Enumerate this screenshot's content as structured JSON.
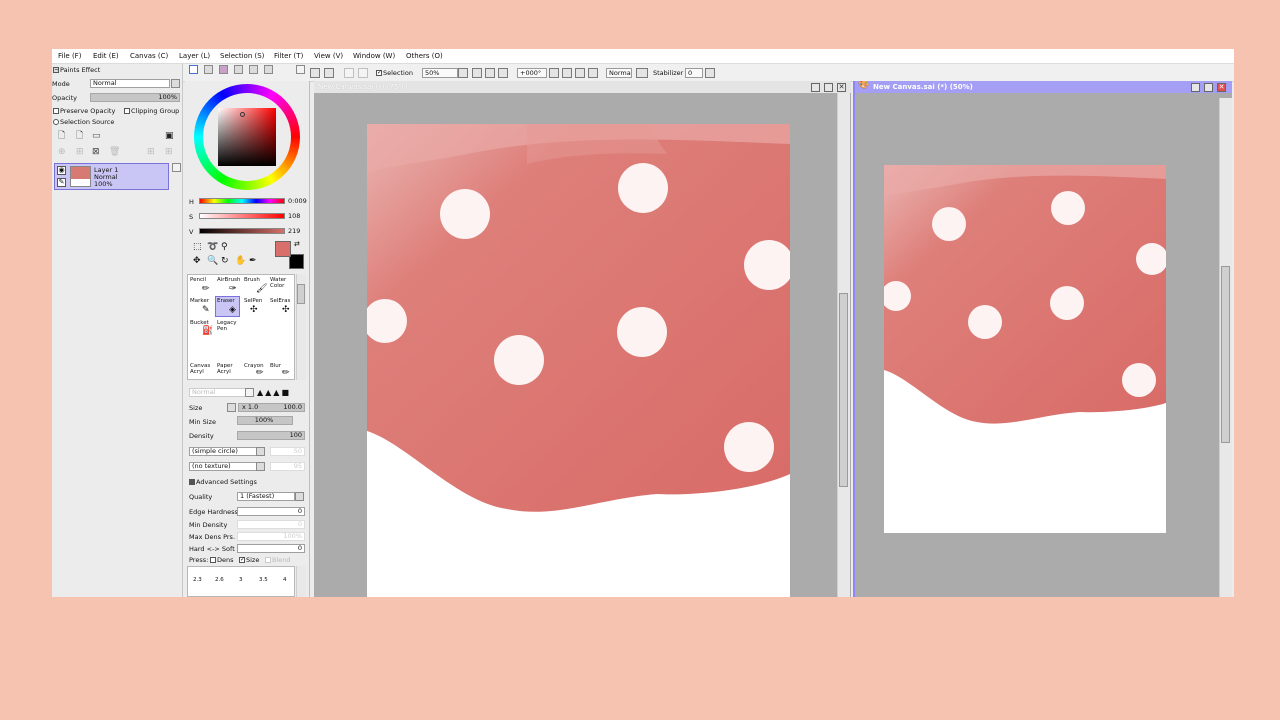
{
  "menu": [
    {
      "label": "File (F)"
    },
    {
      "label": "Edit (E)"
    },
    {
      "label": "Canvas (C)"
    },
    {
      "label": "Layer (L)"
    },
    {
      "label": "Selection (S)"
    },
    {
      "label": "Filter (T)"
    },
    {
      "label": "View (V)"
    },
    {
      "label": "Window (W)"
    },
    {
      "label": "Others (O)"
    }
  ],
  "toolbar": {
    "selection_label": "Selection",
    "zoom": "50%",
    "rotation": "+000°",
    "blend": "Normal",
    "stabilizer_label": "Stabilizer",
    "stabilizer_value": "0"
  },
  "layers_panel": {
    "paints_effect": "Paints Effect",
    "mode_label": "Mode",
    "mode_value": "Normal",
    "opacity_label": "Opacity",
    "opacity_value": "100%",
    "preserve_opacity": "Preserve Opacity",
    "clipping_group": "Clipping Group",
    "selection_source": "Selection Source",
    "layer": {
      "name": "Layer 1",
      "mode": "Normal",
      "opacity": "100%"
    }
  },
  "color": {
    "h_label": "H",
    "h_value": "0:009",
    "s_label": "S",
    "s_value": "108",
    "v_label": "V",
    "v_value": "219",
    "primary": "#d86f6a",
    "secondary": "#000000"
  },
  "tools": [
    {
      "label": "Pencil"
    },
    {
      "label": "AirBrush"
    },
    {
      "label": "Brush"
    },
    {
      "label": "Water Color"
    },
    {
      "label": "Marker"
    },
    {
      "label": "Eraser"
    },
    {
      "label": "SelPen"
    },
    {
      "label": "SelEras"
    },
    {
      "label": "Bucket"
    },
    {
      "label": "Legacy Pen"
    },
    {
      "label": "Canvas Acryl"
    },
    {
      "label": "Paper Acryl"
    },
    {
      "label": "Crayon"
    },
    {
      "label": "Blur"
    }
  ],
  "brush": {
    "blend_mode": "Normal",
    "size_label": "Size",
    "size_mult": "x 1.0",
    "size_value": "100.0",
    "min_size_label": "Min Size",
    "min_size_value": "100%",
    "density_label": "Density",
    "density_value": "100",
    "shape": "(simple circle)",
    "shape_value": "50",
    "texture": "(no texture)",
    "texture_value": "95",
    "advanced": "Advanced Settings",
    "quality_label": "Quality",
    "quality_value": "1 (Fastest)",
    "edge_label": "Edge Hardness",
    "edge_value": "0",
    "min_density_label": "Min Density",
    "min_density_value": "0",
    "max_dens_label": "Max Dens Prs.",
    "max_dens_value": "100%",
    "hard_soft_label": "Hard <-> Soft",
    "hard_soft_value": "0",
    "press_label": "Press:",
    "press_dens": "Dens",
    "press_size": "Size",
    "press_blend": "Blend",
    "sizes": [
      "2.3",
      "2.6",
      "3",
      "3.5",
      "4"
    ]
  },
  "canvas_windows": [
    {
      "title": "New Canvas.sai (*) (75%)"
    },
    {
      "title": "New Canvas.sai (*) (50%)"
    }
  ],
  "icons": [
    "eye-icon",
    "brush-icon",
    "new-layer-icon",
    "folder-icon",
    "trash-icon",
    "eraser-icon",
    "pen-icon",
    "bucket-icon"
  ]
}
